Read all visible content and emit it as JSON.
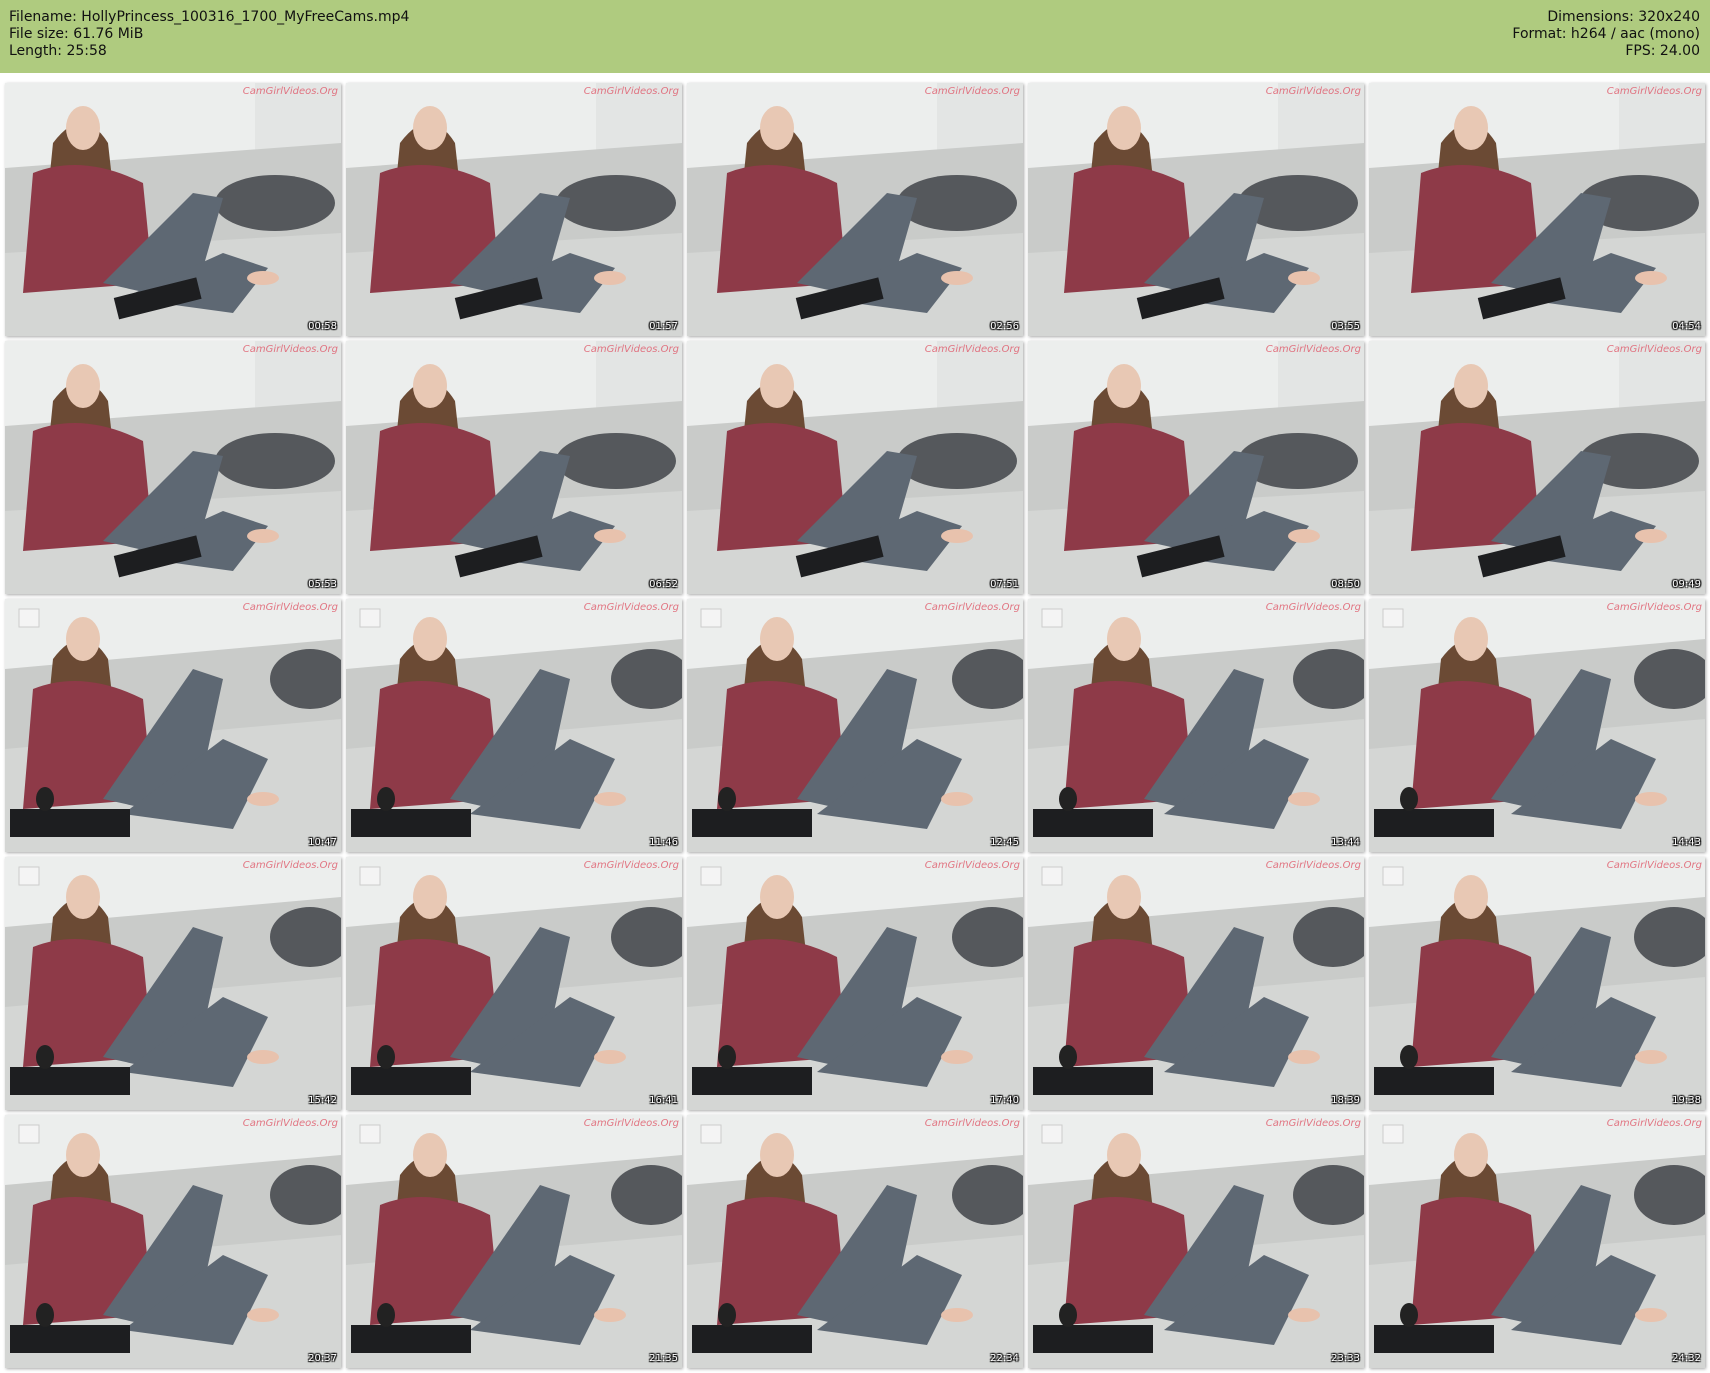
{
  "info": {
    "filename": "Filename: HollyPrincess_100316_1700_MyFreeCams.mp4",
    "filesize": "File size: 61.76 MiB",
    "length": "Length: 25:58",
    "dimensions": "Dimensions: 320x240",
    "format": "Format: h264 / aac (mono)",
    "fps": "FPS: 24.00"
  },
  "watermark": "CamGirlVideos.Org",
  "colors": {
    "header_bg": "#afcb7f",
    "wall": "#eceeed",
    "couch": "#c9cbc9",
    "sweater": "#8e3a48",
    "leggings": "#5e6873",
    "hair": "#6b4a34",
    "keyboard": "#1d1e20"
  },
  "thumbnails": [
    {
      "time": "00:58"
    },
    {
      "time": "01:57"
    },
    {
      "time": "02:56"
    },
    {
      "time": "03:55"
    },
    {
      "time": "04:54"
    },
    {
      "time": "05:53"
    },
    {
      "time": "06:52"
    },
    {
      "time": "07:51"
    },
    {
      "time": "08:50"
    },
    {
      "time": "09:49"
    },
    {
      "time": "10:47"
    },
    {
      "time": "11:46"
    },
    {
      "time": "12:45"
    },
    {
      "time": "13:44"
    },
    {
      "time": "14:43"
    },
    {
      "time": "15:42"
    },
    {
      "time": "16:41"
    },
    {
      "time": "17:40"
    },
    {
      "time": "18:39"
    },
    {
      "time": "19:38"
    },
    {
      "time": "20:37"
    },
    {
      "time": "21:35"
    },
    {
      "time": "22:34"
    },
    {
      "time": "23:33"
    },
    {
      "time": "24:32"
    }
  ]
}
